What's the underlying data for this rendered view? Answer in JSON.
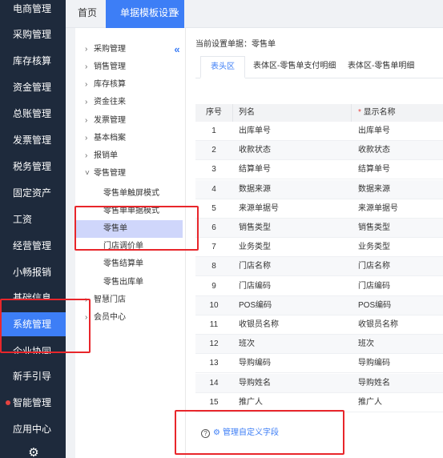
{
  "left_nav": {
    "items": [
      {
        "label": "电商管理"
      },
      {
        "label": "采购管理"
      },
      {
        "label": "库存核算"
      },
      {
        "label": "资金管理"
      },
      {
        "label": "总账管理"
      },
      {
        "label": "发票管理"
      },
      {
        "label": "税务管理"
      },
      {
        "label": "固定资产"
      },
      {
        "label": "工资"
      },
      {
        "label": "经营管理"
      },
      {
        "label": "小畅报销"
      },
      {
        "label": "基础信息"
      },
      {
        "label": "系统管理"
      },
      {
        "label": "企业协同"
      },
      {
        "label": "新手引导"
      },
      {
        "label": "智能管理"
      },
      {
        "label": "应用中心"
      }
    ],
    "active_label": "系统管理",
    "colors": {
      "background": "#1e2a3c",
      "active": "#3d7ef6",
      "dot": "#e64340"
    }
  },
  "top_tabs": {
    "home": "首页",
    "active": "单据模板设置",
    "close": "×"
  },
  "tree": {
    "collapse": "«",
    "nodes": [
      {
        "arrow": "›",
        "label": "采购管理"
      },
      {
        "arrow": "›",
        "label": "销售管理"
      },
      {
        "arrow": "›",
        "label": "库存核算"
      },
      {
        "arrow": "›",
        "label": "资金往来"
      },
      {
        "arrow": "›",
        "label": "发票管理"
      },
      {
        "arrow": "›",
        "label": "基本档案"
      },
      {
        "arrow": "›",
        "label": "报销单"
      },
      {
        "arrow": "˅",
        "label": "零售管理"
      }
    ],
    "leaves": [
      {
        "label": "零售单触屏模式"
      },
      {
        "label": "零售单单据模式"
      },
      {
        "label": "零售单"
      },
      {
        "label": "门店调价单"
      },
      {
        "label": "零售结算单"
      },
      {
        "label": "零售出库单"
      }
    ],
    "after_nodes": [
      {
        "arrow": "›",
        "label": "智慧门店"
      },
      {
        "arrow": "›",
        "label": "会员中心"
      }
    ],
    "selected": "零售单"
  },
  "main": {
    "current_doc": "当前设置单据：零售单",
    "tabs": [
      {
        "label": "表头区"
      },
      {
        "label": "表体区-零售单支付明细"
      },
      {
        "label": "表体区-零售单明细"
      }
    ],
    "table": {
      "headers": {
        "seq": "序号",
        "column": "列名",
        "required_mark": "*",
        "display": "显示名称"
      },
      "rows": [
        {
          "seq": "1",
          "column": "出库单号",
          "display": "出库单号"
        },
        {
          "seq": "2",
          "column": "收款状态",
          "display": "收款状态"
        },
        {
          "seq": "3",
          "column": "结算单号",
          "display": "结算单号"
        },
        {
          "seq": "4",
          "column": "数据来源",
          "display": "数据来源"
        },
        {
          "seq": "5",
          "column": "来源单据号",
          "display": "来源单据号"
        },
        {
          "seq": "6",
          "column": "销售类型",
          "display": "销售类型"
        },
        {
          "seq": "7",
          "column": "业务类型",
          "display": "业务类型"
        },
        {
          "seq": "8",
          "column": "门店名称",
          "display": "门店名称"
        },
        {
          "seq": "9",
          "column": "门店编码",
          "display": "门店编码"
        },
        {
          "seq": "10",
          "column": "POS编码",
          "display": "POS编码"
        },
        {
          "seq": "11",
          "column": "收银员名称",
          "display": "收银员名称"
        },
        {
          "seq": "12",
          "column": "班次",
          "display": "班次"
        },
        {
          "seq": "13",
          "column": "导购编码",
          "display": "导购编码"
        },
        {
          "seq": "14",
          "column": "导购姓名",
          "display": "导购姓名"
        },
        {
          "seq": "15",
          "column": "推广人",
          "display": "推广人"
        }
      ]
    },
    "footer": {
      "help": "?",
      "gear": "⚙",
      "link": "管理自定义字段"
    }
  },
  "bottom_gear": "⚙",
  "accent_color": "#3d7ef6",
  "highlight_color": "#e8262b"
}
